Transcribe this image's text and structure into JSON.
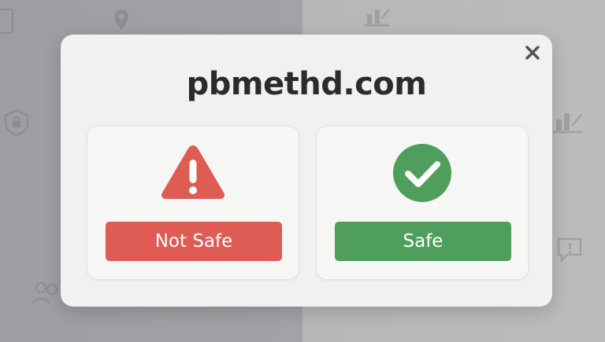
{
  "dialog": {
    "domain": "pbmethd.com",
    "not_safe_label": "Not Safe",
    "safe_label": "Safe"
  },
  "icons": {
    "close": "close-icon",
    "warning": "warning-icon",
    "check": "checkmark-icon"
  },
  "colors": {
    "not_safe": "#de5c53",
    "safe": "#4f9e5b",
    "title": "#2b2b2b"
  }
}
